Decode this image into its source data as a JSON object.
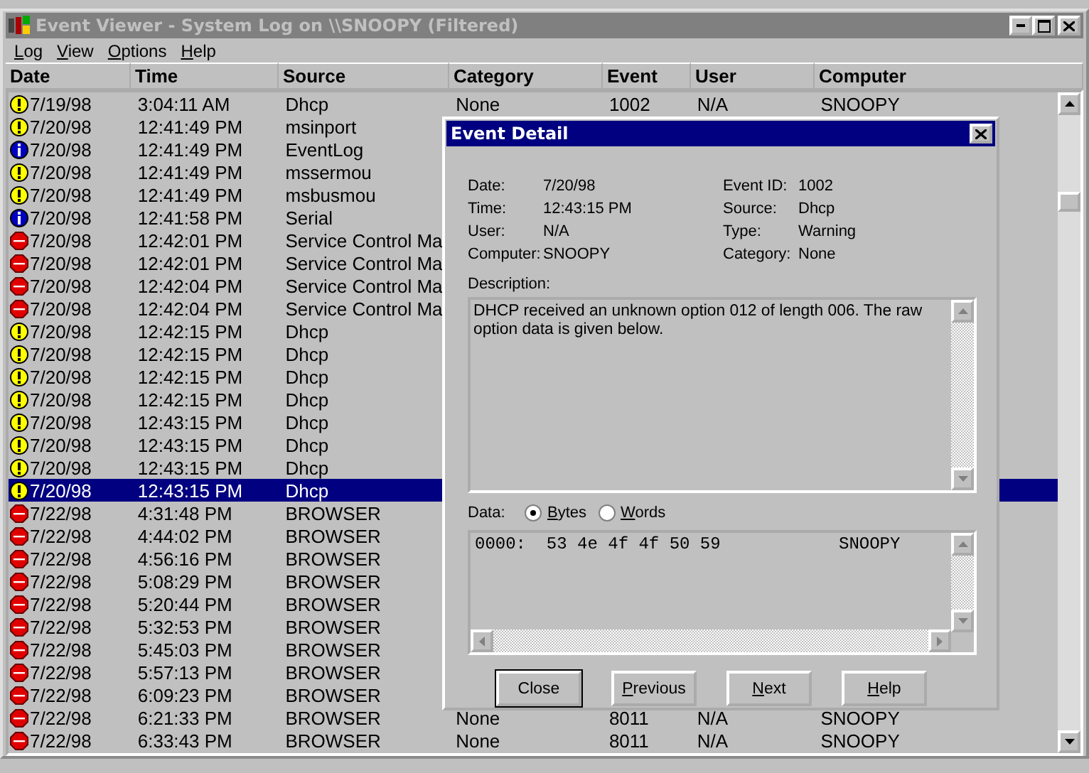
{
  "window": {
    "title": "Event Viewer - System Log on \\\\SNOOPY (Filtered)"
  },
  "menu": [
    {
      "label": "Log",
      "mnemonic": true
    },
    {
      "label": "View",
      "mnemonic": true
    },
    {
      "label": "Options",
      "mnemonic": true
    },
    {
      "label": "Help",
      "mnemonic": true
    }
  ],
  "columns": [
    "Date",
    "Time",
    "Source",
    "Category",
    "Event",
    "User",
    "Computer"
  ],
  "rows": [
    {
      "kind": "warning",
      "selected": false,
      "date": "7/19/98",
      "time": "3:04:11 AM",
      "source": "Dhcp",
      "category": "None",
      "event": "1002",
      "user": "N/A",
      "computer": "SNOOPY"
    },
    {
      "kind": "warning",
      "selected": false,
      "date": "7/20/98",
      "time": "12:41:49 PM",
      "source": "msinport"
    },
    {
      "kind": "info",
      "selected": false,
      "date": "7/20/98",
      "time": "12:41:49 PM",
      "source": "EventLog"
    },
    {
      "kind": "warning",
      "selected": false,
      "date": "7/20/98",
      "time": "12:41:49 PM",
      "source": "mssermou"
    },
    {
      "kind": "warning",
      "selected": false,
      "date": "7/20/98",
      "time": "12:41:49 PM",
      "source": "msbusmou"
    },
    {
      "kind": "info",
      "selected": false,
      "date": "7/20/98",
      "time": "12:41:58 PM",
      "source": "Serial"
    },
    {
      "kind": "error",
      "selected": false,
      "date": "7/20/98",
      "time": "12:42:01 PM",
      "source": "Service Control Ma"
    },
    {
      "kind": "error",
      "selected": false,
      "date": "7/20/98",
      "time": "12:42:01 PM",
      "source": "Service Control Ma"
    },
    {
      "kind": "error",
      "selected": false,
      "date": "7/20/98",
      "time": "12:42:04 PM",
      "source": "Service Control Ma"
    },
    {
      "kind": "error",
      "selected": false,
      "date": "7/20/98",
      "time": "12:42:04 PM",
      "source": "Service Control Ma"
    },
    {
      "kind": "warning",
      "selected": false,
      "date": "7/20/98",
      "time": "12:42:15 PM",
      "source": "Dhcp"
    },
    {
      "kind": "warning",
      "selected": false,
      "date": "7/20/98",
      "time": "12:42:15 PM",
      "source": "Dhcp"
    },
    {
      "kind": "warning",
      "selected": false,
      "date": "7/20/98",
      "time": "12:42:15 PM",
      "source": "Dhcp"
    },
    {
      "kind": "warning",
      "selected": false,
      "date": "7/20/98",
      "time": "12:42:15 PM",
      "source": "Dhcp"
    },
    {
      "kind": "warning",
      "selected": false,
      "date": "7/20/98",
      "time": "12:43:15 PM",
      "source": "Dhcp"
    },
    {
      "kind": "warning",
      "selected": false,
      "date": "7/20/98",
      "time": "12:43:15 PM",
      "source": "Dhcp"
    },
    {
      "kind": "warning",
      "selected": false,
      "date": "7/20/98",
      "time": "12:43:15 PM",
      "source": "Dhcp"
    },
    {
      "kind": "warning",
      "selected": true,
      "date": "7/20/98",
      "time": "12:43:15 PM",
      "source": "Dhcp"
    },
    {
      "kind": "error",
      "selected": false,
      "date": "7/22/98",
      "time": "4:31:48 PM",
      "source": "BROWSER"
    },
    {
      "kind": "error",
      "selected": false,
      "date": "7/22/98",
      "time": "4:44:02 PM",
      "source": "BROWSER"
    },
    {
      "kind": "error",
      "selected": false,
      "date": "7/22/98",
      "time": "4:56:16 PM",
      "source": "BROWSER"
    },
    {
      "kind": "error",
      "selected": false,
      "date": "7/22/98",
      "time": "5:08:29 PM",
      "source": "BROWSER"
    },
    {
      "kind": "error",
      "selected": false,
      "date": "7/22/98",
      "time": "5:20:44 PM",
      "source": "BROWSER"
    },
    {
      "kind": "error",
      "selected": false,
      "date": "7/22/98",
      "time": "5:32:53 PM",
      "source": "BROWSER"
    },
    {
      "kind": "error",
      "selected": false,
      "date": "7/22/98",
      "time": "5:45:03 PM",
      "source": "BROWSER"
    },
    {
      "kind": "error",
      "selected": false,
      "date": "7/22/98",
      "time": "5:57:13 PM",
      "source": "BROWSER"
    },
    {
      "kind": "error",
      "selected": false,
      "date": "7/22/98",
      "time": "6:09:23 PM",
      "source": "BROWSER"
    },
    {
      "kind": "error",
      "selected": false,
      "date": "7/22/98",
      "time": "6:21:33 PM",
      "source": "BROWSER",
      "category": "None",
      "event": "8011",
      "user": "N/A",
      "computer": "SNOOPY"
    },
    {
      "kind": "error",
      "selected": false,
      "date": "7/22/98",
      "time": "6:33:43 PM",
      "source": "BROWSER",
      "category": "None",
      "event": "8011",
      "user": "N/A",
      "computer": "SNOOPY"
    }
  ],
  "dialog": {
    "title": "Event Detail",
    "left_fields": [
      {
        "label": "Date:",
        "value": "7/20/98"
      },
      {
        "label": "Time:",
        "value": "12:43:15 PM"
      },
      {
        "label": "User:",
        "value": "N/A"
      },
      {
        "label": "Computer:",
        "value": "SNOOPY"
      }
    ],
    "right_fields": [
      {
        "label": "Event ID:",
        "value": "1002"
      },
      {
        "label": "Source:",
        "value": "Dhcp"
      },
      {
        "label": "Type:",
        "value": "Warning"
      },
      {
        "label": "Category:",
        "value": "None"
      }
    ],
    "description_label": "Description:",
    "description": "DHCP received an unknown option 012 of length 006. The raw option data is given below.",
    "data_label": "Data:",
    "data_formats": [
      {
        "label": "Bytes",
        "selected": true
      },
      {
        "label": "Words",
        "selected": false
      }
    ],
    "data_lines": [
      {
        "hex": "0000:  53 4e 4f 4f 50 59",
        "ascii": "SNOOPY"
      }
    ],
    "buttons": [
      {
        "label": "Close",
        "default": true,
        "mnemonic": false
      },
      {
        "label": "Previous",
        "default": false,
        "mnemonic": true
      },
      {
        "label": "Next",
        "default": false,
        "mnemonic": true
      },
      {
        "label": "Help",
        "default": false,
        "mnemonic": true
      }
    ]
  }
}
